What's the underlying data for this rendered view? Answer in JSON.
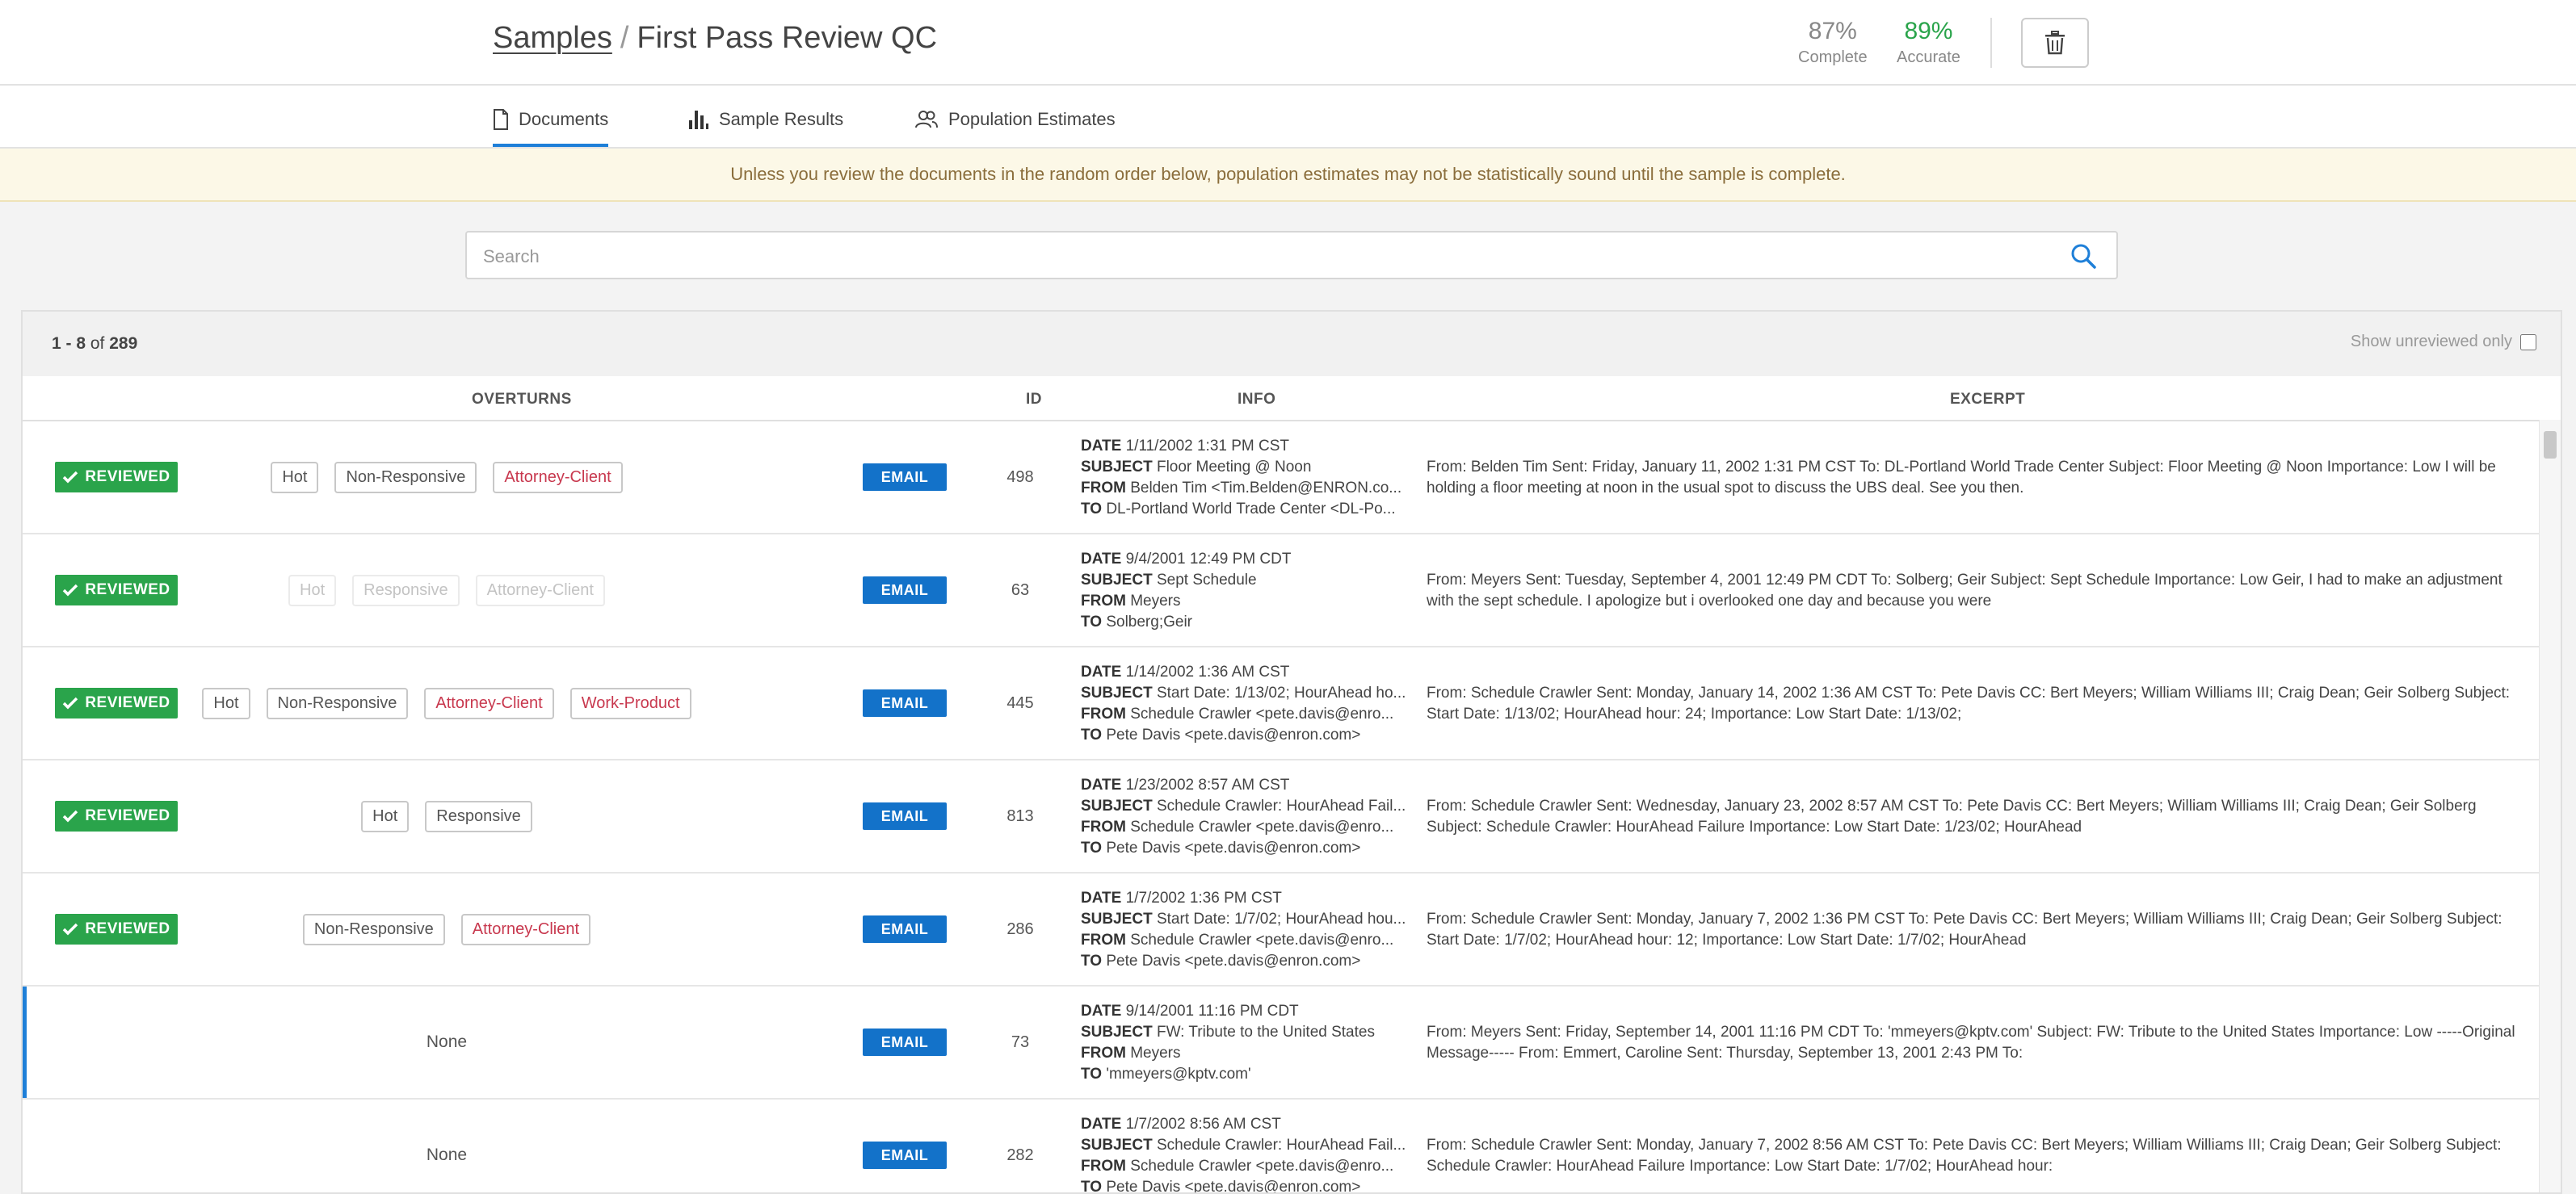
{
  "header": {
    "breadcrumb_root": "Samples",
    "separator": "/",
    "title": "First Pass Review QC",
    "complete_value": "87%",
    "complete_label": "Complete",
    "accurate_value": "89%",
    "accurate_label": "Accurate"
  },
  "tabs": [
    {
      "label": "Documents",
      "active": true
    },
    {
      "label": "Sample Results",
      "active": false
    },
    {
      "label": "Population Estimates",
      "active": false
    }
  ],
  "banner": "Unless you review the documents in the random order below, population estimates may not be statistically sound until the sample is complete.",
  "search": {
    "placeholder": "Search"
  },
  "pager": {
    "range": "1 - 8",
    "of": "of",
    "total": "289"
  },
  "unreviewed_label": "Show unreviewed only",
  "columns": {
    "overturns": "OVERTURNS",
    "id": "ID",
    "info": "INFO",
    "excerpt": "EXCERPT"
  },
  "info_labels": {
    "date": "DATE",
    "subject": "SUBJECT",
    "from": "FROM",
    "to": "TO"
  },
  "rows": [
    {
      "status": "REVIEWED",
      "tags": [
        {
          "label": "Hot",
          "style": "normal"
        },
        {
          "label": "Non-Responsive",
          "style": "normal"
        },
        {
          "label": "Attorney-Client",
          "style": "priv"
        }
      ],
      "type": "EMAIL",
      "id": "498",
      "date": "1/11/2002 1:31 PM CST",
      "subject": "Floor Meeting @ Noon",
      "from": "Belden Tim <Tim.Belden@ENRON.co...",
      "to": "DL-Portland World Trade Center <DL-Po...",
      "excerpt": "From: Belden Tim Sent: Friday, January 11, 2002 1:31 PM CST To: DL-Portland World Trade Center Subject: Floor Meeting @ Noon Importance: Low I will be holding a floor meeting at noon in the usual spot to discuss the UBS deal. See you then."
    },
    {
      "status": "REVIEWED",
      "tags": [
        {
          "label": "Hot",
          "style": "faded"
        },
        {
          "label": "Responsive",
          "style": "faded"
        },
        {
          "label": "Attorney-Client",
          "style": "faded"
        }
      ],
      "type": "EMAIL",
      "id": "63",
      "date": "9/4/2001 12:49 PM CDT",
      "subject": "Sept Schedule",
      "from": "Meyers",
      "to": "Solberg;Geir",
      "excerpt": "From: Meyers Sent: Tuesday, September 4, 2001 12:49 PM CDT To: Solberg; Geir Subject: Sept Schedule Importance: Low Geir, I had to make an adjustment with the sept schedule. I apologize but i overlooked one day and because you were"
    },
    {
      "status": "REVIEWED",
      "tags": [
        {
          "label": "Hot",
          "style": "normal"
        },
        {
          "label": "Non-Responsive",
          "style": "normal"
        },
        {
          "label": "Attorney-Client",
          "style": "priv"
        },
        {
          "label": "Work-Product",
          "style": "priv"
        }
      ],
      "type": "EMAIL",
      "id": "445",
      "date": "1/14/2002 1:36 AM CST",
      "subject": "Start Date: 1/13/02; HourAhead ho...",
      "from": "Schedule Crawler <pete.davis@enro...",
      "to": "Pete Davis <pete.davis@enron.com>",
      "excerpt": "From: Schedule Crawler Sent: Monday, January 14, 2002 1:36 AM CST To: Pete Davis CC: Bert Meyers; William Williams III; Craig Dean; Geir Solberg Subject: Start Date: 1/13/02; HourAhead hour: 24; Importance: Low Start Date: 1/13/02;"
    },
    {
      "status": "REVIEWED",
      "tags": [
        {
          "label": "Hot",
          "style": "normal"
        },
        {
          "label": "Responsive",
          "style": "normal"
        }
      ],
      "type": "EMAIL",
      "id": "813",
      "date": "1/23/2002 8:57 AM CST",
      "subject": "Schedule Crawler: HourAhead Fail...",
      "from": "Schedule Crawler <pete.davis@enro...",
      "to": "Pete Davis <pete.davis@enron.com>",
      "excerpt": "From: Schedule Crawler Sent: Wednesday, January 23, 2002 8:57 AM CST To: Pete Davis CC: Bert Meyers; William Williams III; Craig Dean; Geir Solberg Subject: Schedule Crawler: HourAhead Failure Importance: Low Start Date: 1/23/02; HourAhead"
    },
    {
      "status": "REVIEWED",
      "tags": [
        {
          "label": "Non-Responsive",
          "style": "normal"
        },
        {
          "label": "Attorney-Client",
          "style": "priv"
        }
      ],
      "type": "EMAIL",
      "id": "286",
      "date": "1/7/2002 1:36 PM CST",
      "subject": "Start Date: 1/7/02; HourAhead hou...",
      "from": "Schedule Crawler <pete.davis@enro...",
      "to": "Pete Davis <pete.davis@enron.com>",
      "excerpt": "From: Schedule Crawler Sent: Monday, January 7, 2002 1:36 PM CST To: Pete Davis CC: Bert Meyers; William Williams III; Craig Dean; Geir Solberg Subject: Start Date: 1/7/02; HourAhead hour: 12; Importance: Low Start Date: 1/7/02; HourAhead"
    },
    {
      "status": "",
      "tags": [],
      "none_label": "None",
      "selected": true,
      "type": "EMAIL",
      "id": "73",
      "date": "9/14/2001 11:16 PM CDT",
      "subject": "FW: Tribute to the United States",
      "from": "Meyers",
      "to": "'mmeyers@kptv.com'",
      "excerpt": "From: Meyers Sent: Friday, September 14, 2001 11:16 PM CDT To: 'mmeyers@kptv.com' Subject: FW: Tribute to the United States Importance: Low -----Original Message----- From: Emmert, Caroline Sent: Thursday, September 13, 2001 2:43 PM To:"
    },
    {
      "status": "",
      "tags": [],
      "none_label": "None",
      "type": "EMAIL",
      "id": "282",
      "date": "1/7/2002 8:56 AM CST",
      "subject": "Schedule Crawler: HourAhead Fail...",
      "from": "Schedule Crawler <pete.davis@enro...",
      "to": "Pete Davis <pete.davis@enron.com>",
      "excerpt": "From: Schedule Crawler Sent: Monday, January 7, 2002 8:56 AM CST To: Pete Davis CC: Bert Meyers; William Williams III; Craig Dean; Geir Solberg Subject: Schedule Crawler: HourAhead Failure Importance: Low Start Date: 1/7/02; HourAhead hour:"
    }
  ],
  "colors": {
    "reviewed": "#2aa44b",
    "email": "#1372c9",
    "accent": "#1e7fd8",
    "privileged": "#c8384e"
  }
}
